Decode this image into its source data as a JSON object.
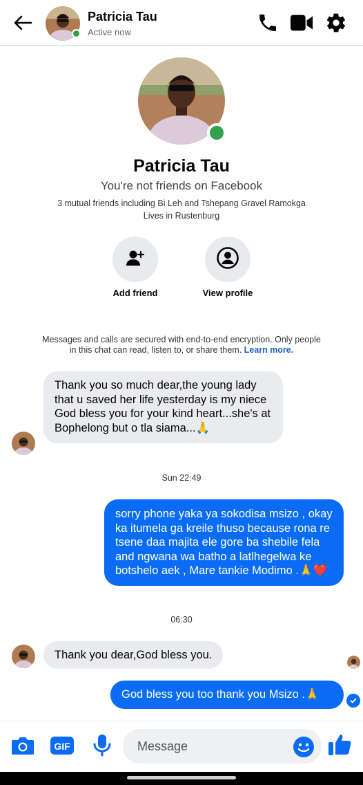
{
  "header": {
    "name": "Patricia Tau",
    "status": "Active now"
  },
  "profile": {
    "name": "Patricia Tau",
    "friend_status": "You're not friends on Facebook",
    "mutual_friends": "3 mutual friends including Bi Leh and Tshepang Gravel Ramokga",
    "lives_in": "Lives in Rustenburg",
    "actions": [
      {
        "label": "Add friend",
        "icon": "add-person-icon"
      },
      {
        "label": "View profile",
        "icon": "user-circle-icon"
      }
    ]
  },
  "encryption": {
    "text": "Messages and calls are secured with end-to-end encryption. Only people in this chat can read, listen to, or share them.",
    "link": "Learn more."
  },
  "messages": [
    {
      "direction": "incoming",
      "text": "Thank you so much dear,the young lady that u saved her life yesterday is my niece God bless you for your kind heart...she's at Bophelong but o tla siama...🙏"
    },
    {
      "timestamp": "Sun 22:49"
    },
    {
      "direction": "outgoing",
      "text": "sorry phone yaka ya sokodisa msizo , okay ka itumela ga kreile thuso because rona re tsene daa majita ele gore ba shebile fela and ngwana wa batho a latlhegelwa ke botshelo aek , Mare tankie Modimo .🙏❤️"
    },
    {
      "timestamp": "06:30"
    },
    {
      "direction": "incoming",
      "text": "Thank you dear,God bless you."
    },
    {
      "direction": "outgoing",
      "text": "God bless you too thank you Msizo .🙏"
    }
  ],
  "composer": {
    "placeholder": "Message",
    "gif_label": "GIF"
  },
  "colors": {
    "accent": "#0a6cf5",
    "online": "#31a24c",
    "incoming_bubble": "#eaebef",
    "link": "#1b5fbf"
  }
}
